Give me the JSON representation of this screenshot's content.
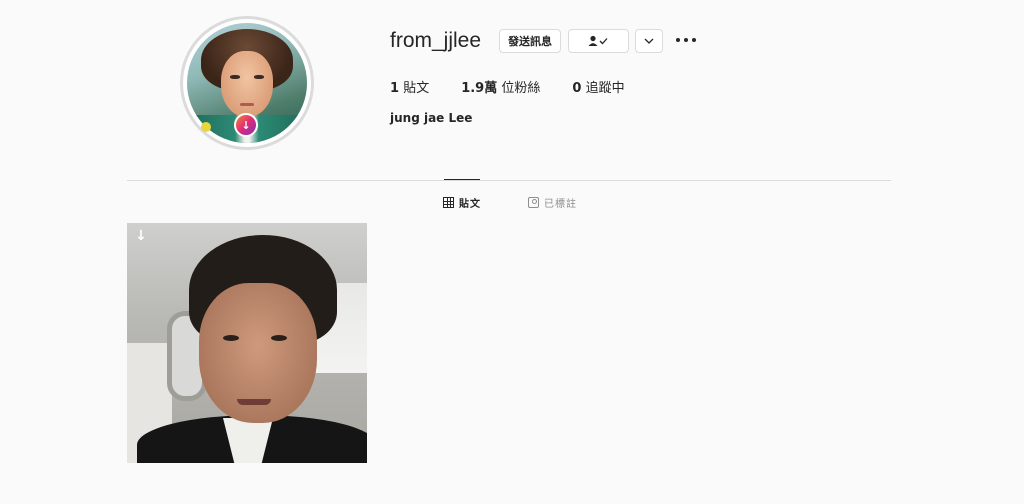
{
  "profile": {
    "username": "from_jjlee",
    "full_name": "jung jae Lee",
    "avatar_icon": "profile-avatar",
    "avatar_badge_icon": "download-icon"
  },
  "header": {
    "message_label": "發送訊息",
    "follow_label": "👤✓",
    "chevron_label": "⌄",
    "more_icon": "more-options-icon"
  },
  "stats": {
    "posts": {
      "value": "1",
      "label": "貼文"
    },
    "followers": {
      "value": "1.9萬",
      "label": "位粉絲"
    },
    "following": {
      "value": "0",
      "label": "追蹤中"
    }
  },
  "tabs": [
    {
      "label": "貼文",
      "icon": "grid-icon",
      "active": true
    },
    {
      "label": "已標註",
      "icon": "tag-icon",
      "active": false
    }
  ],
  "posts": [
    {
      "image": "selfie-photo",
      "overlay_icon": "download-arrow-icon",
      "overlay_glyph": "↓"
    }
  ],
  "colors": {
    "background": "#fafafa",
    "border": "#dbdbdb",
    "text": "#262626",
    "muted": "#8e8e8e"
  }
}
